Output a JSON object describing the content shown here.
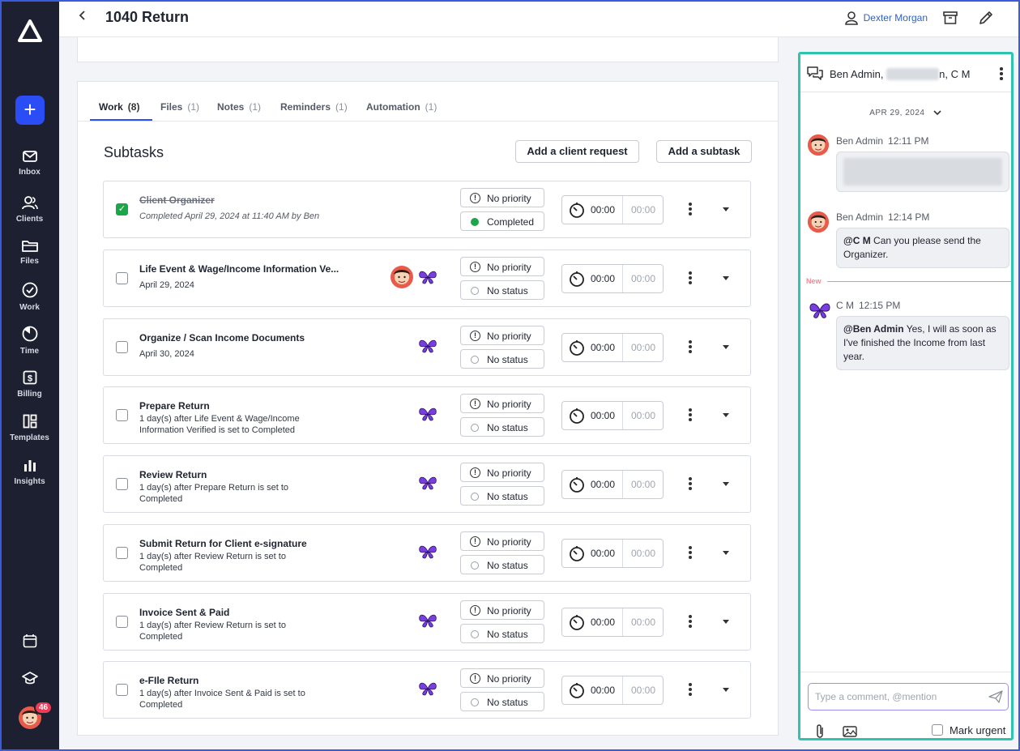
{
  "header": {
    "title": "1040 Return",
    "user_name": "Dexter Morgan"
  },
  "sidebar": {
    "items": [
      {
        "label": "Inbox",
        "icon": "mail-icon"
      },
      {
        "label": "Clients",
        "icon": "clients-icon"
      },
      {
        "label": "Files",
        "icon": "folder-icon"
      },
      {
        "label": "Work",
        "icon": "check-circle-icon"
      },
      {
        "label": "Time",
        "icon": "clock-icon"
      },
      {
        "label": "Billing",
        "icon": "billing-icon"
      },
      {
        "label": "Templates",
        "icon": "templates-icon"
      },
      {
        "label": "Insights",
        "icon": "bar-chart-icon"
      }
    ],
    "notification_count": "46",
    "add_label": "+"
  },
  "tabs": [
    {
      "label": "Work",
      "count": "(8)"
    },
    {
      "label": "Files",
      "count": "(1)"
    },
    {
      "label": "Notes",
      "count": "(1)"
    },
    {
      "label": "Reminders",
      "count": "(1)"
    },
    {
      "label": "Automation",
      "count": "(1)"
    }
  ],
  "subtasks": {
    "title": "Subtasks",
    "add_client_request": "Add a client request",
    "add_subtask": "Add a subtask",
    "rows": [
      {
        "title": "Client Organizer",
        "subtitle": "Completed April 29, 2024 at 11:40 AM by Ben",
        "priority": "No priority",
        "status": "Completed",
        "timer": "00:00",
        "timer_est": "00:00"
      },
      {
        "title": "Life Event & Wage/Income Information Ve...",
        "subtitle": "April 29, 2024",
        "priority": "No priority",
        "status": "No status",
        "timer": "00:00",
        "timer_est": "00:00"
      },
      {
        "title": "Organize / Scan Income Documents",
        "subtitle": "April 30, 2024",
        "priority": "No priority",
        "status": "No status",
        "timer": "00:00",
        "timer_est": "00:00"
      },
      {
        "title": "Prepare Return",
        "subtitle": "1 day(s) after Life Event & Wage/Income Information Verified is set to Completed",
        "priority": "No priority",
        "status": "No status",
        "timer": "00:00",
        "timer_est": "00:00"
      },
      {
        "title": "Review Return",
        "subtitle": "1 day(s) after Prepare Return is set to Completed",
        "priority": "No priority",
        "status": "No status",
        "timer": "00:00",
        "timer_est": "00:00"
      },
      {
        "title": "Submit Return for Client e-signature",
        "subtitle": "1 day(s) after Review Return is set to Completed",
        "priority": "No priority",
        "status": "No status",
        "timer": "00:00",
        "timer_est": "00:00"
      },
      {
        "title": "Invoice Sent & Paid",
        "subtitle": "1 day(s) after Review Return is set to Completed",
        "priority": "No priority",
        "status": "No status",
        "timer": "00:00",
        "timer_est": "00:00"
      },
      {
        "title": "e-FIle Return",
        "subtitle": "1 day(s) after Invoice Sent & Paid is set to Completed",
        "priority": "No priority",
        "status": "No status",
        "timer": "00:00",
        "timer_est": "00:00"
      }
    ]
  },
  "chat": {
    "names_prefix": "Ben Admin,",
    "names_suffix": "n, C M",
    "date": "APR 29, 2024",
    "messages": [
      {
        "author": "Ben Admin",
        "time": "12:11 PM"
      },
      {
        "author": "Ben Admin",
        "time": "12:14 PM",
        "mention": "@C M",
        "text": "Can you please send the Organizer."
      },
      {
        "author": "C M",
        "time": "12:15 PM",
        "mention": "@Ben Admin",
        "text": "Yes, I will as soon as I've finished the Income from last year."
      }
    ],
    "new_label": "New",
    "input_placeholder": "Type a comment, @mention",
    "mark_urgent": "Mark urgent"
  }
}
